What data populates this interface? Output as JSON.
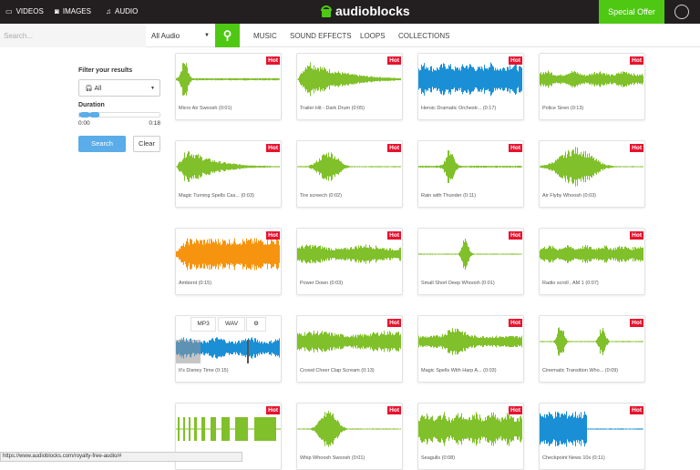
{
  "topnav": {
    "items": [
      {
        "label": "VIDEOS",
        "icon": "video-icon"
      },
      {
        "label": "IMAGES",
        "icon": "camera-icon"
      },
      {
        "label": "AUDIO",
        "icon": "music-note-icon"
      }
    ],
    "logo": "audioblocks",
    "special_offer": "Special Offer"
  },
  "search": {
    "placeholder": "Search...",
    "category": "All Audio",
    "categories_nav": [
      "MUSIC",
      "SOUND EFFECTS",
      "LOOPS",
      "COLLECTIONS"
    ]
  },
  "filter": {
    "title": "Filter your results",
    "type": "All",
    "duration_label": "Duration",
    "min": "0:00",
    "max": "0:18",
    "search": "Search",
    "clear": "Clear"
  },
  "colors": {
    "green": "#80c02a",
    "blue": "#1a8fd6",
    "orange": "#f7940f",
    "hot": "#e8112d",
    "accent": "#4fc814"
  },
  "hot_label": "Hot",
  "cards": [
    {
      "title": "Micro Air Swoosh (0:01)",
      "color": "#80c02a",
      "hot": true
    },
    {
      "title": "Trailer Hit - Dark Drum (0:05)",
      "color": "#80c02a",
      "hot": true
    },
    {
      "title": "Heroic Dramatic Orchestr... (0:17)",
      "color": "#1a8fd6",
      "hot": true
    },
    {
      "title": "Police Siren (0:13)",
      "color": "#80c02a",
      "hot": true
    },
    {
      "title": "Magic Turning Spells Cas... (0:03)",
      "color": "#80c02a",
      "hot": true
    },
    {
      "title": "Tire screech (0:02)",
      "color": "#80c02a",
      "hot": true
    },
    {
      "title": "Rain with Thunder (0:11)",
      "color": "#80c02a",
      "hot": true
    },
    {
      "title": "Air Flyby Whoosh (0:03)",
      "color": "#80c02a",
      "hot": true
    },
    {
      "title": "Ambient (0:15)",
      "color": "#f7940f",
      "hot": true
    },
    {
      "title": "Power Down (0:03)",
      "color": "#80c02a",
      "hot": true
    },
    {
      "title": "Small Short Deep Whoosh (0:01)",
      "color": "#80c02a",
      "hot": true
    },
    {
      "title": "Radio scroll , AM 1 (0:07)",
      "color": "#80c02a",
      "hot": true
    },
    {
      "title": "It's Disney Time (0:15)",
      "color": "#1a8fd6",
      "hot": false,
      "formats": [
        "MP3",
        "WAV"
      ]
    },
    {
      "title": "Crowd Cheer Clap Scream (0:13)",
      "color": "#80c02a",
      "hot": true
    },
    {
      "title": "Magic Spells With Harp A... (0:03)",
      "color": "#80c02a",
      "hot": true
    },
    {
      "title": "Cinematic Transition Who... (0:09)",
      "color": "#80c02a",
      "hot": true
    },
    {
      "title": "",
      "color": "#80c02a",
      "hot": true
    },
    {
      "title": "Whip Whoosh Swoosh (0:01)",
      "color": "#80c02a",
      "hot": true
    },
    {
      "title": "Seagulls (0:08)",
      "color": "#80c02a",
      "hot": true
    },
    {
      "title": "Checkpoint News 10s (0:11)",
      "color": "#1a8fd6",
      "hot": true
    }
  ],
  "status_url": "https://www.audioblocks.com/royalty-free-audio/#"
}
